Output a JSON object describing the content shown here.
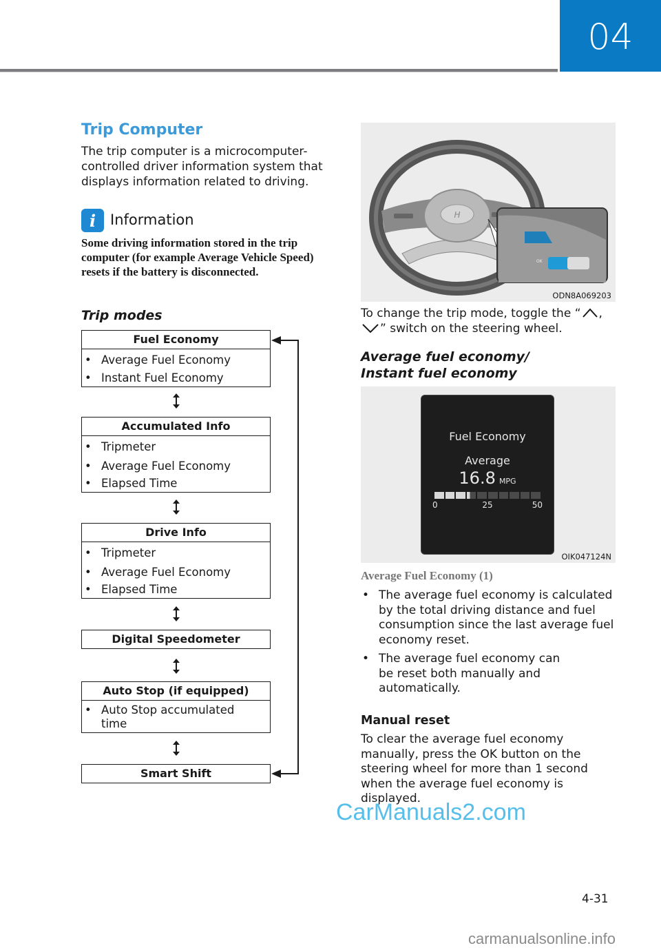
{
  "header": {
    "chapter": "04",
    "accent_color": "#0a7ac4"
  },
  "left": {
    "section_title": "Trip Computer",
    "intro": "The trip computer is a microcomputer-controlled driver information system that displays information related to driving.",
    "info": {
      "icon": "info-icon",
      "icon_glyph": "i",
      "title": "Information",
      "body": "Some driving information stored in the trip computer (for example Average Vehicle Speed) resets if the battery is disconnected."
    },
    "trip_modes_title": "Trip modes",
    "bullet": "•",
    "modes": [
      {
        "title": "Fuel Economy",
        "items": [
          "Average Fuel Economy",
          "Instant Fuel Economy"
        ]
      },
      {
        "title": "Accumulated Info",
        "items": [
          "Tripmeter",
          "Average Fuel Economy",
          "Elapsed Time"
        ]
      },
      {
        "title": "Drive Info",
        "items": [
          "Tripmeter",
          "Average Fuel Economy",
          "Elapsed Time"
        ]
      },
      {
        "title": "Digital Speedometer",
        "items": []
      },
      {
        "title": "Auto Stop (if equipped)",
        "items": [
          "Auto Stop accumulated time"
        ]
      },
      {
        "title": "Smart Shift",
        "items": []
      }
    ]
  },
  "right": {
    "figure1": {
      "alt": "Steering wheel with trip mode toggle switch highlighted",
      "code": "ODN8A069203",
      "switch_label": "OK"
    },
    "toggle_text_before": "To change the trip mode, toggle the “",
    "toggle_text_mid": ",",
    "toggle_text_after": "” switch on the steering wheel.",
    "toggle_icons": [
      "chevron-up-icon",
      "chevron-down-icon"
    ],
    "subsection_title_1": "Average fuel economy/",
    "subsection_title_2": "Instant fuel economy",
    "figure2": {
      "code": "OIK047124N",
      "screen_title": "Fuel Economy",
      "label": "Average",
      "value": "16.8",
      "unit": "MPG",
      "scale_min": "0",
      "scale_mid": "25",
      "scale_max": "50",
      "gauge_value": 16.8,
      "gauge_max": 50,
      "gauge_segments": 10
    },
    "avg_heading": "Average Fuel Economy (1)",
    "avg_bullets": [
      "The average fuel economy is calculated by the total driving distance and fuel consumption since the last average fuel economy reset.",
      "The average fuel economy can be reset both manually and automatically."
    ],
    "manual_reset_title": "Manual reset",
    "manual_reset_body": "To clear the average fuel economy manually, press the OK button on the steering wheel for more than 1 second when the average fuel economy is displayed."
  },
  "footer": {
    "page_number": "4-31",
    "watermark_1": "CarManuals2.com",
    "watermark_2": "carmanualsonline.info"
  }
}
